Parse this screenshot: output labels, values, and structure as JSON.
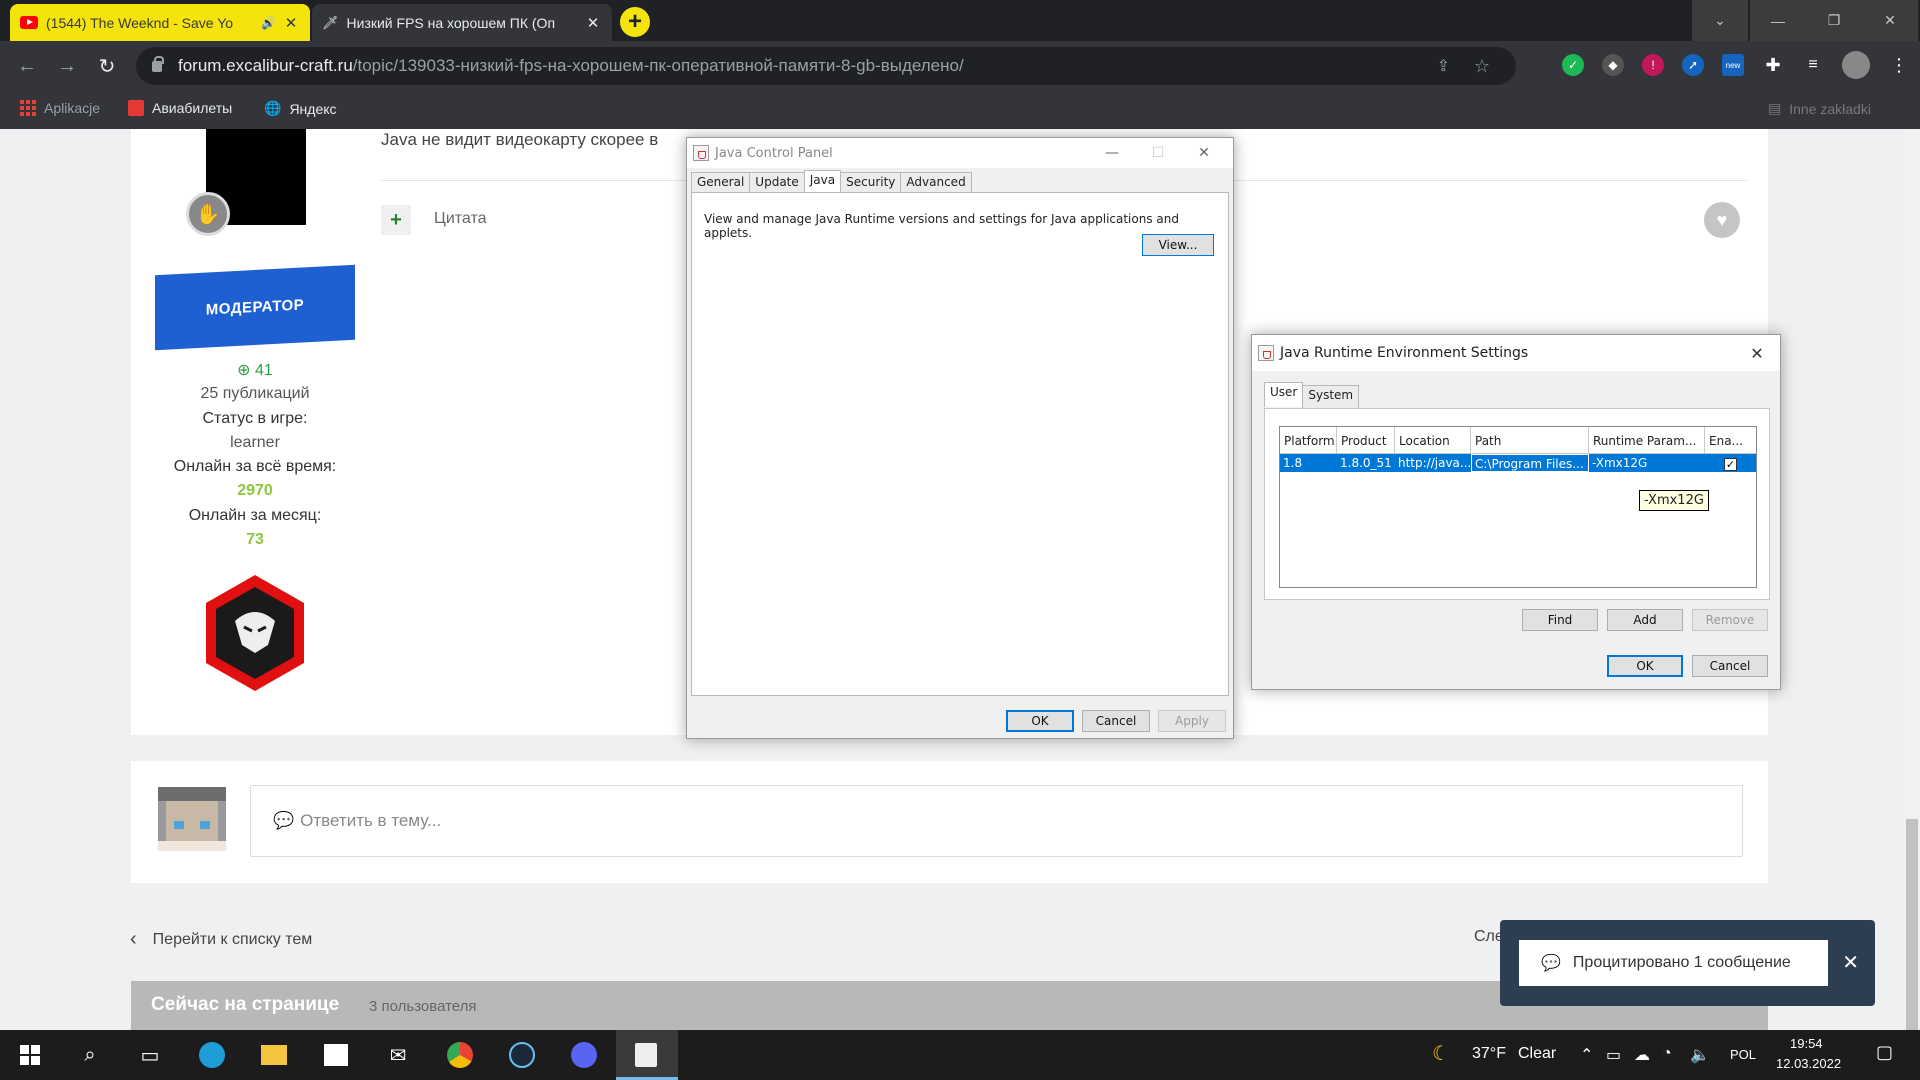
{
  "browser": {
    "tabs": [
      {
        "title": "(1544) The Weeknd - Save Yo",
        "icon": "youtube-icon"
      },
      {
        "title": "Низкий FPS на хорошем ПК (Оп",
        "icon": "sword-icon"
      }
    ],
    "url_host": "forum.excalibur-craft.ru",
    "url_path": "/topic/139033-низкий-fps-на-хорошем-пк-оперативной-памяти-8-gb-выделено/",
    "bookmarks": [
      {
        "label": "Aplikacje"
      },
      {
        "label": "Авиабилеты"
      },
      {
        "label": "Яндекс"
      }
    ],
    "other_bookmarks": "Inne zakładki"
  },
  "post": {
    "text": "Java не видит видеокарту скорее в",
    "quote_label": "Цитата",
    "author": {
      "rank": "МОДЕРАТОР",
      "reputation": "41",
      "posts": "25 публикаций",
      "status_label": "Статус в игре:",
      "status_value": "learner",
      "online_total_label": "Онлайн за всё время:",
      "online_total": "2970",
      "online_month_label": "Онлайн за месяц:",
      "online_month": "73"
    }
  },
  "reply": {
    "placeholder": "Ответить в тему..."
  },
  "nav": {
    "back": "Перейти к списку тем",
    "next": "Сле"
  },
  "now_on_page": {
    "title": "Сейчас на странице",
    "count": "3 пользователя"
  },
  "toast": {
    "text": "Процитировано 1 сообщение"
  },
  "jcp": {
    "title": "Java Control Panel",
    "tabs": [
      "General",
      "Update",
      "Java",
      "Security",
      "Advanced"
    ],
    "description": "View and manage Java Runtime versions and settings for Java applications and applets.",
    "view_button": "View...",
    "ok": "OK",
    "cancel": "Cancel",
    "apply": "Apply"
  },
  "jre": {
    "title": "Java Runtime Environment Settings",
    "tabs": [
      "User",
      "System"
    ],
    "columns": [
      "Platform",
      "Product",
      "Location",
      "Path",
      "Runtime Param...",
      "Ena..."
    ],
    "row": {
      "platform": "1.8",
      "product": "1.8.0_51",
      "location": "http://java...",
      "path": "C:\\Program Files...",
      "params": "-Xmx12G",
      "enabled": true
    },
    "tooltip": "-Xmx12G",
    "find": "Find",
    "add": "Add",
    "remove": "Remove",
    "ok": "OK",
    "cancel": "Cancel"
  },
  "taskbar": {
    "weather_temp": "37°F",
    "weather_desc": "Clear",
    "lang": "POL",
    "time": "19:54",
    "date": "12.03.2022"
  },
  "colors": {
    "accent": "#0078d7",
    "moderator_blue": "#1e5fd1",
    "stat_green": "#8cc63f",
    "tab_yellow": "#f4e40b"
  }
}
